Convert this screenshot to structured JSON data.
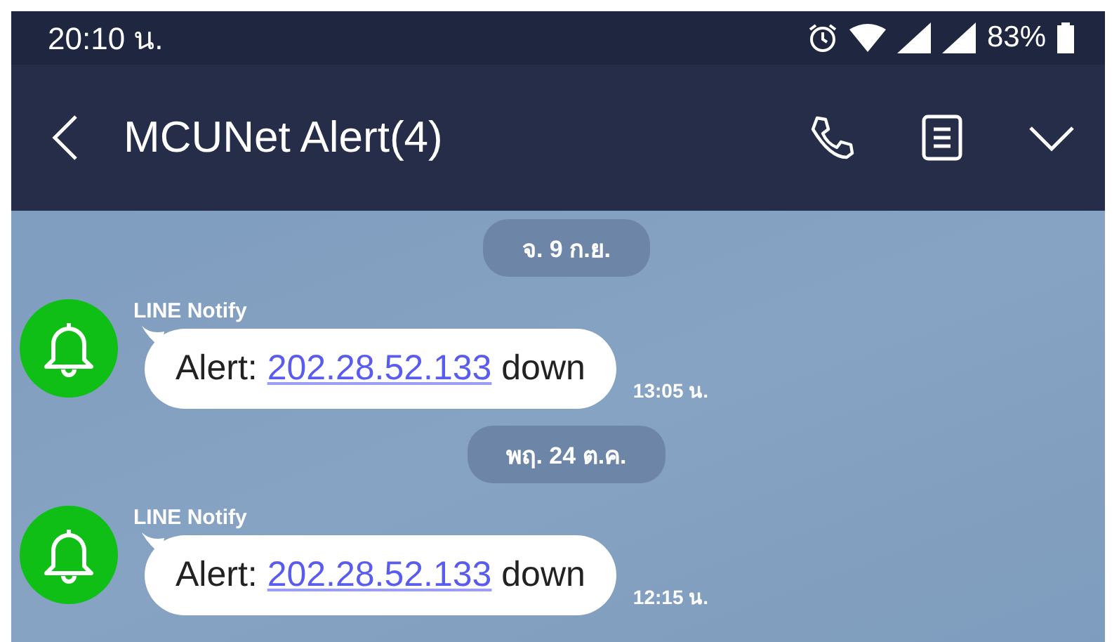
{
  "status_bar": {
    "time": "20:10 น.",
    "battery": "83%"
  },
  "header": {
    "title": "MCUNet Alert(4)"
  },
  "messages": [
    {
      "date": "จ. 9 ก.ย.",
      "sender": "LINE Notify",
      "prefix": "Alert:",
      "link": "202.28.52.133",
      "suffix": "down",
      "time": "13:05 น."
    },
    {
      "date": "พฤ. 24 ต.ค.",
      "sender": "LINE Notify",
      "prefix": "Alert:",
      "link": "202.28.52.133",
      "suffix": "down",
      "time": "12:15 น."
    }
  ]
}
